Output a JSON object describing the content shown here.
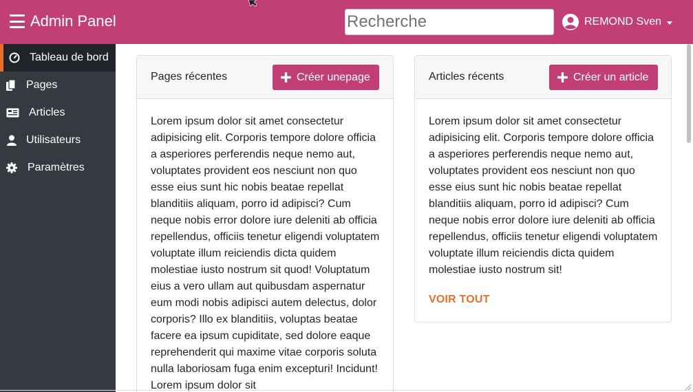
{
  "navbar": {
    "brand": "Admin Panel",
    "search_placeholder": "Recherche",
    "user_name": "REMOND Sven",
    "accent_color": "#c13f76"
  },
  "sidebar": {
    "items": [
      {
        "label": "Tableau de bord",
        "icon": "dashboard-gauge-icon",
        "active": true
      },
      {
        "label": "Pages",
        "icon": "copy-pages-icon",
        "active": false
      },
      {
        "label": "Articles",
        "icon": "newspaper-icon",
        "active": false
      },
      {
        "label": "Utilisateurs",
        "icon": "user-icon",
        "active": false
      },
      {
        "label": "Paramètres",
        "icon": "gear-icon",
        "active": false
      }
    ],
    "active_marker_color": "#e8702a"
  },
  "pages_card": {
    "title": "Pages récentes",
    "button_label": "Créer unepage",
    "body": "Lorem ipsum dolor sit amet consectetur adipisicing elit. Corporis tempore dolore officia a asperiores perferendis neque nemo aut, voluptates provident eos nesciunt non quo esse eius sunt hic nobis beatae repellat blanditiis aliquam, porro id adipisci? Cum neque nobis error dolore iure deleniti ab officia repellendus, officiis tenetur eligendi voluptatem voluptate illum reiciendis dicta quidem molestiae iusto nostrum sit quod! Voluptatum eius a vero ullam aut quibusdam aspernatur eum modi nobis adipisci autem delectus, dolor corporis? Illo ex blanditiis, voluptas beatae facere ea ipsum cupiditate, sed dolore eaque reprehenderit qui maxime vitae corporis soluta nulla laboriosam fuga enim excepturi! Incidunt! Lorem ipsum dolor sit"
  },
  "articles_card": {
    "title": "Articles récents",
    "button_label": "Créer un article",
    "body": "Lorem ipsum dolor sit amet consectetur adipisicing elit. Corporis tempore dolore officia a asperiores perferendis neque nemo aut, voluptates provident eos nesciunt non quo esse eius sunt hic nobis beatae repellat blanditiis aliquam, porro id adipisci? Cum neque nobis error dolore iure deleniti ab officia repellendus, officiis tenetur eligendi voluptatem voluptate illum reiciendis dicta quidem molestiae iusto nostrum sit!",
    "link_label": "VOIR TOUT",
    "link_color": "#e8702a"
  }
}
